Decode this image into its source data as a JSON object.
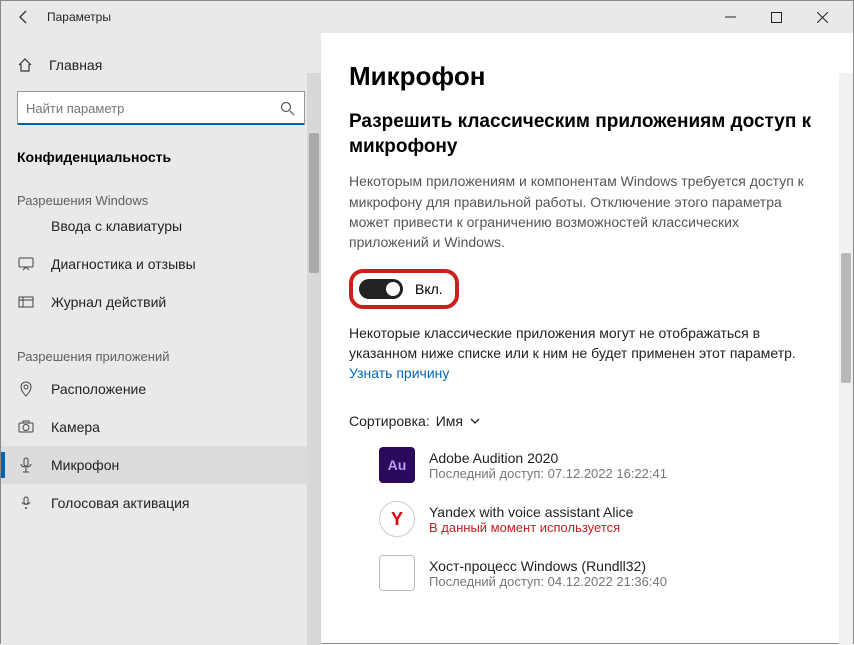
{
  "titlebar": {
    "title": "Параметры"
  },
  "sidebar": {
    "home": "Главная",
    "search_placeholder": "Найти параметр",
    "header": "Конфиденциальность",
    "section1": "Разрешения Windows",
    "items1": [
      "Ввода с клавиатуры",
      "Диагностика и отзывы",
      "Журнал действий"
    ],
    "section2": "Разрешения приложений",
    "items2": [
      "Расположение",
      "Камера",
      "Микрофон",
      "Голосовая активация"
    ]
  },
  "main": {
    "title": "Микрофон",
    "subtitle": "Разрешить классическим приложениям доступ к микрофону",
    "desc": "Некоторым приложениям и компонентам Windows требуется доступ к микрофону для правильной работы. Отключение этого параметра может привести к ограничению возможностей классических приложений и Windows.",
    "toggle_label": "Вкл.",
    "desc2a": "Некоторые классические приложения могут не отображаться в указанном ниже списке или к ним не будет применен этот параметр.",
    "link": "Узнать причину",
    "sort_label": "Сортировка:",
    "sort_value": "Имя",
    "apps": [
      {
        "name": "Adobe Audition 2020",
        "sub": "Последний доступ: 07.12.2022 16:22:41",
        "inuse": false,
        "icon": "au"
      },
      {
        "name": "Yandex with voice assistant Alice",
        "sub": "В данный момент используется",
        "inuse": true,
        "icon": "ya"
      },
      {
        "name": "Хост-процесс Windows (Rundll32)",
        "sub": "Последний доступ: 04.12.2022 21:36:40",
        "inuse": false,
        "icon": "blank"
      }
    ]
  }
}
